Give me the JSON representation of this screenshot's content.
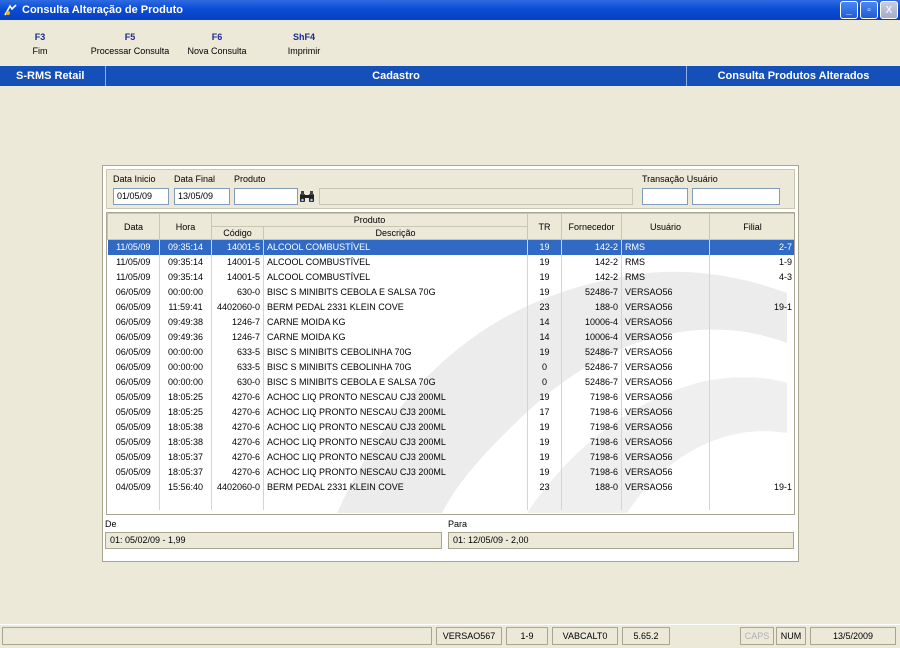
{
  "window": {
    "title": "Consulta Alteração de Produto",
    "buttons": [
      "_",
      "▫",
      "X"
    ]
  },
  "fkeys": [
    {
      "key": "F3",
      "label": "Fim"
    },
    {
      "key": "F5",
      "label": "Processar Consulta"
    },
    {
      "key": "F6",
      "label": "Nova Consulta"
    },
    {
      "key": "ShF4",
      "label": "Imprimir"
    }
  ],
  "header": {
    "left": "S-RMS Retail",
    "center": "Cadastro",
    "right": "Consulta Produtos Alterados"
  },
  "filters": {
    "data_inicio_label": "Data Inicio",
    "data_inicio": "01/05/09",
    "data_final_label": "Data Final",
    "data_final": "13/05/09",
    "produto_label": "Produto",
    "produto": "",
    "produto_desc": "",
    "transacao_label": "Transação Usuário",
    "transacao": "",
    "usuario": ""
  },
  "table": {
    "headers": {
      "data": "Data",
      "hora": "Hora",
      "produto": "Produto",
      "codigo": "Código",
      "descricao": "Descrição",
      "tr": "TR",
      "fornecedor": "Fornecedor",
      "usuario": "Usuário",
      "filial": "Filial"
    },
    "rows": [
      [
        "11/05/09",
        "09:35:14",
        "14001-5",
        "ALCOOL COMBUSTÍVEL",
        "19",
        "142-2",
        "RMS",
        "2-7"
      ],
      [
        "11/05/09",
        "09:35:14",
        "14001-5",
        "ALCOOL COMBUSTÍVEL",
        "19",
        "142-2",
        "RMS",
        "1-9"
      ],
      [
        "11/05/09",
        "09:35:14",
        "14001-5",
        "ALCOOL COMBUSTÍVEL",
        "19",
        "142-2",
        "RMS",
        "4-3"
      ],
      [
        "06/05/09",
        "00:00:00",
        "630-0",
        "BISC S MINIBITS CEBOLA E SALSA 70G",
        "19",
        "52486-7",
        "VERSAO56",
        ""
      ],
      [
        "06/05/09",
        "11:59:41",
        "4402060-0",
        "BERM PEDAL 2331 KLEIN COVE",
        "23",
        "188-0",
        "VERSAO56",
        "19-1"
      ],
      [
        "06/05/09",
        "09:49:38",
        "1246-7",
        "CARNE MOIDA KG",
        "14",
        "10006-4",
        "VERSAO56",
        ""
      ],
      [
        "06/05/09",
        "09:49:36",
        "1246-7",
        "CARNE MOIDA KG",
        "14",
        "10006-4",
        "VERSAO56",
        ""
      ],
      [
        "06/05/09",
        "00:00:00",
        "633-5",
        "BISC S MINIBITS CEBOLINHA 70G",
        "19",
        "52486-7",
        "VERSAO56",
        ""
      ],
      [
        "06/05/09",
        "00:00:00",
        "633-5",
        "BISC S MINIBITS CEBOLINHA 70G",
        "0",
        "52486-7",
        "VERSAO56",
        ""
      ],
      [
        "06/05/09",
        "00:00:00",
        "630-0",
        "BISC S MINIBITS CEBOLA E SALSA 70G",
        "0",
        "52486-7",
        "VERSAO56",
        ""
      ],
      [
        "05/05/09",
        "18:05:25",
        "4270-6",
        "ACHOC LIQ PRONTO NESCAU CJ3 200ML",
        "19",
        "7198-6",
        "VERSAO56",
        ""
      ],
      [
        "05/05/09",
        "18:05:25",
        "4270-6",
        "ACHOC LIQ PRONTO NESCAU CJ3 200ML",
        "17",
        "7198-6",
        "VERSAO56",
        ""
      ],
      [
        "05/05/09",
        "18:05:38",
        "4270-6",
        "ACHOC LIQ PRONTO NESCAU CJ3 200ML",
        "19",
        "7198-6",
        "VERSAO56",
        ""
      ],
      [
        "05/05/09",
        "18:05:38",
        "4270-6",
        "ACHOC LIQ PRONTO NESCAU CJ3 200ML",
        "19",
        "7198-6",
        "VERSAO56",
        ""
      ],
      [
        "05/05/09",
        "18:05:37",
        "4270-6",
        "ACHOC LIQ PRONTO NESCAU CJ3 200ML",
        "19",
        "7198-6",
        "VERSAO56",
        ""
      ],
      [
        "05/05/09",
        "18:05:37",
        "4270-6",
        "ACHOC LIQ PRONTO NESCAU CJ3 200ML",
        "19",
        "7198-6",
        "VERSAO56",
        ""
      ],
      [
        "04/05/09",
        "15:56:40",
        "4402060-0",
        "BERM PEDAL 2331 KLEIN COVE",
        "23",
        "188-0",
        "VERSAO56",
        "19-1"
      ]
    ]
  },
  "de": {
    "label": "De",
    "value": "01: 05/02/09 -    1,99"
  },
  "para": {
    "label": "Para",
    "value": "01: 12/05/09 -    2,00"
  },
  "status": [
    "VERSAO567",
    "1-9",
    "VABCALT0",
    "5.65.2",
    "CAPS",
    "NUM",
    "13/5/2009"
  ],
  "colors": {
    "title": "#0A4CD6",
    "header": "#1450B8",
    "selection": "#316AC5",
    "fkey": "#1B2A8F"
  }
}
